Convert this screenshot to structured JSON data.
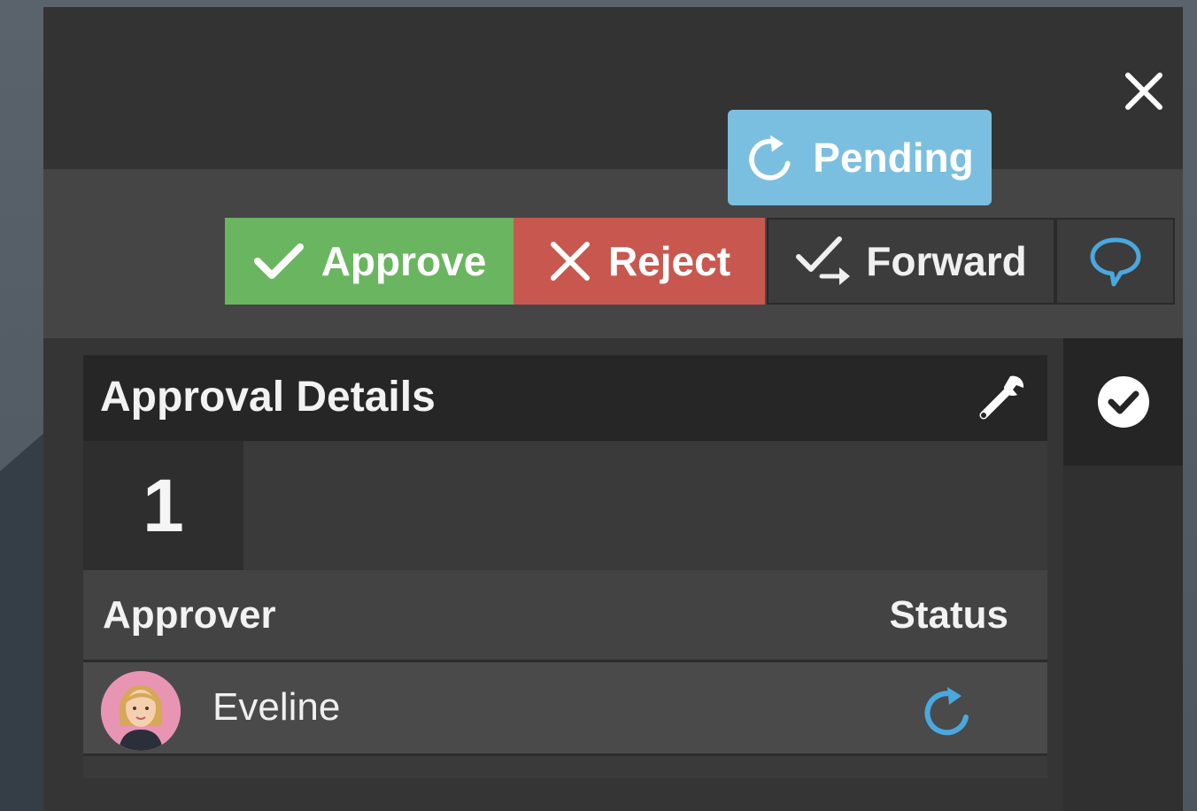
{
  "dialog": {
    "close_icon": "close-icon"
  },
  "toolbar": {
    "approve_label": "Approve",
    "approve_icon": "checkmark-icon",
    "reject_label": "Reject",
    "reject_icon": "x-icon",
    "forward_label": "Forward",
    "forward_icon": "forward-check-icon",
    "comment_icon": "speech-bubble-icon",
    "colors": {
      "approve": "#6ab55f",
      "reject": "#c8584f",
      "comment_icon": "#4aa8df"
    }
  },
  "sidebar": {
    "check_icon": "check-circle-icon"
  },
  "approval_details": {
    "title": "Approval Details",
    "settings_icon": "wrench-icon",
    "step_number": "1",
    "status_badge": {
      "label": "Pending",
      "icon": "refresh-icon",
      "color": "#7bbfe0"
    },
    "table": {
      "columns": [
        "Approver",
        "Status"
      ],
      "rows": [
        {
          "approver": "Eveline",
          "avatar": "avatar-female-blonde",
          "status_icon": "refresh-icon",
          "status_color": "#4aa8df"
        }
      ]
    }
  }
}
